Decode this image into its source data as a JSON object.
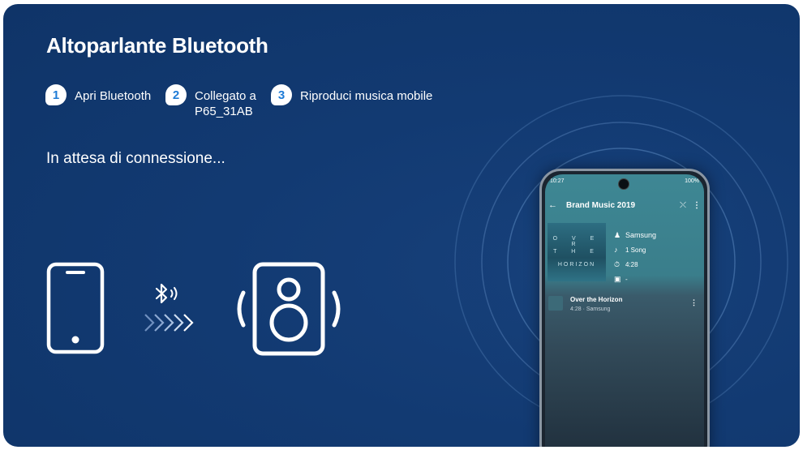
{
  "header": {
    "title": "Altoparlante Bluetooth"
  },
  "steps": [
    {
      "number": "1",
      "label": "Apri Bluetooth"
    },
    {
      "number": "2",
      "label": "Collegato a",
      "label_line2": "P65_31AB"
    },
    {
      "number": "3",
      "label": "Riproduci musica mobile"
    }
  ],
  "status": {
    "text": "In attesa di connessione..."
  },
  "icons": {
    "phone": "smartphone-icon",
    "bluetooth": "bluetooth-icon",
    "arrows": "chevrons-right-icon",
    "speaker": "speaker-icon"
  },
  "mockup": {
    "status_time": "10:27",
    "status_right": "100%",
    "app_title": "Brand Music 2019",
    "album_art_text": [
      "O V E R",
      "T H E",
      "HORIZON"
    ],
    "artist": "Samsung",
    "song_count": "1 Song",
    "duration": "4:28",
    "date": "-",
    "track": {
      "name": "Over the Horizon",
      "subtitle": "4:28 · Samsung"
    }
  },
  "colors": {
    "background": "#123a72",
    "badge_text": "#1e7bd6",
    "accent_white": "#ffffff"
  }
}
